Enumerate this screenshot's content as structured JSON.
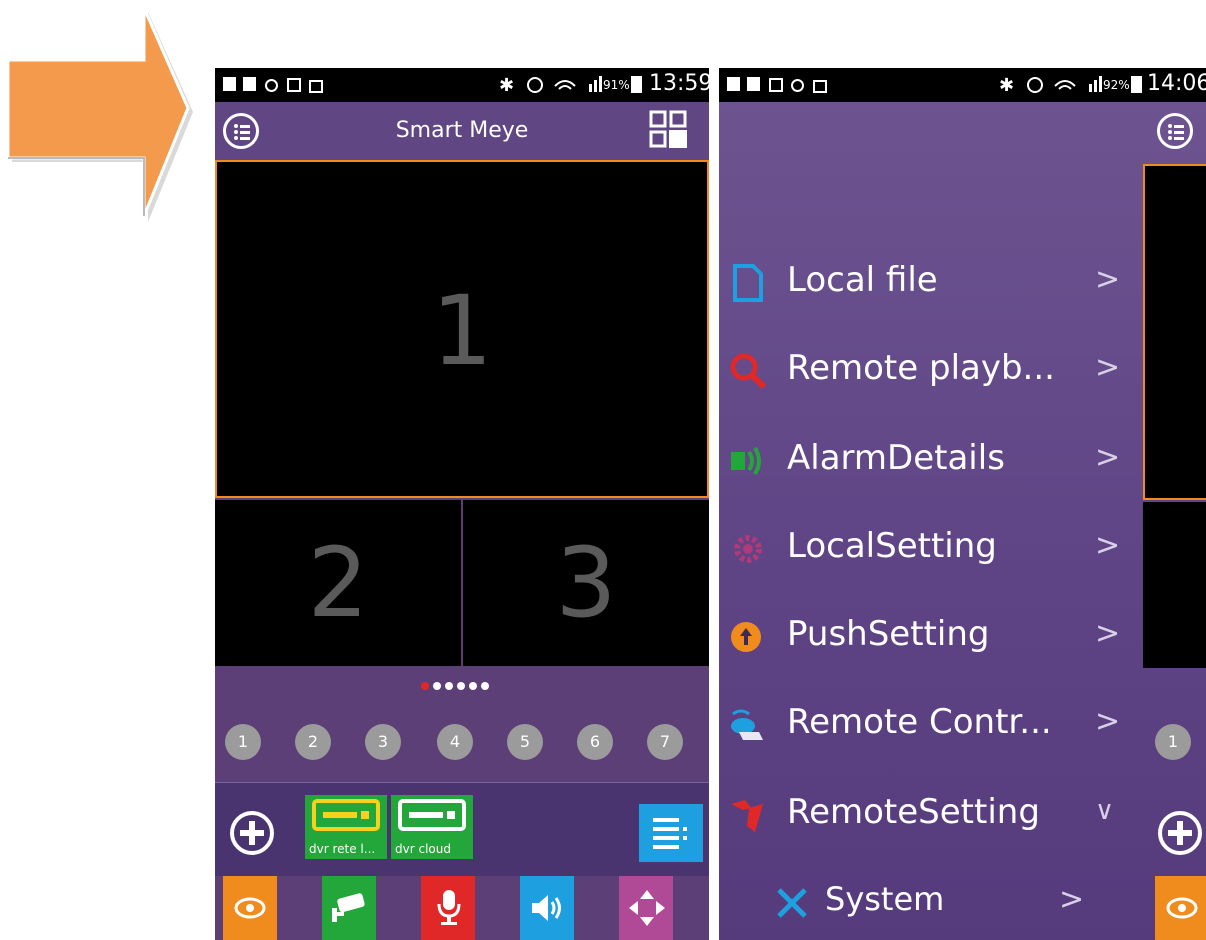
{
  "phone1": {
    "status": {
      "battery": "91%",
      "time": "13:59"
    },
    "title": "Smart Meye",
    "icons": {
      "menu": "list-menu-icon",
      "layout": "grid-layout-icon"
    },
    "cells": [
      "1",
      "2",
      "3"
    ],
    "page_dots": {
      "count": 6,
      "active": 0
    },
    "channels": [
      "1",
      "2",
      "3",
      "4",
      "5",
      "6",
      "7"
    ],
    "devices": [
      {
        "label": "dvr rete l...",
        "status": "selected"
      },
      {
        "label": "dvr cloud",
        "status": "normal"
      }
    ],
    "toolbar": [
      {
        "icon": "ptz-icon",
        "color": "#f08c1e"
      },
      {
        "icon": "camera-icon",
        "color": "#23a63a"
      },
      {
        "icon": "microphone-icon",
        "color": "#e02828"
      },
      {
        "icon": "speaker-icon",
        "color": "#1ea0e0"
      },
      {
        "icon": "direction-arrows-icon",
        "color": "#b04a96"
      }
    ]
  },
  "phone2": {
    "status": {
      "battery": "92%",
      "time": "14:06"
    },
    "menu": [
      {
        "label": "Local file",
        "icon": "file-icon",
        "chevron": ">"
      },
      {
        "label": "Remote playb...",
        "icon": "search-icon",
        "chevron": ">"
      },
      {
        "label": "AlarmDetails",
        "icon": "alarm-icon",
        "chevron": ">"
      },
      {
        "label": "LocalSetting",
        "icon": "gear-icon",
        "chevron": ">"
      },
      {
        "label": "PushSetting",
        "icon": "push-icon",
        "chevron": ">"
      },
      {
        "label": "Remote Contr...",
        "icon": "remote-control-icon",
        "chevron": ">"
      },
      {
        "label": "RemoteSetting",
        "icon": "tools-icon",
        "chevron": "∨"
      },
      {
        "label": "System",
        "icon": "wrench-icon",
        "chevron": ">"
      }
    ],
    "side_channel": "1"
  }
}
